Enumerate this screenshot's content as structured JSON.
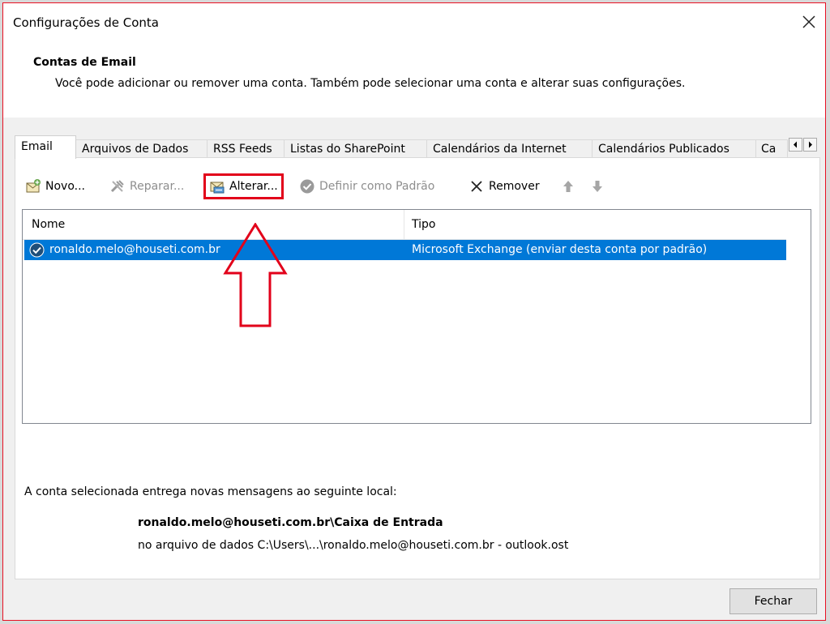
{
  "window": {
    "title": "Configurações de Conta"
  },
  "header": {
    "section_title": "Contas de Email",
    "description": "Você pode adicionar ou remover uma conta. Também pode selecionar uma conta e alterar suas configurações."
  },
  "tabs": [
    {
      "label": "Email",
      "active": true
    },
    {
      "label": "Arquivos de Dados"
    },
    {
      "label": "RSS Feeds"
    },
    {
      "label": "Listas do SharePoint"
    },
    {
      "label": "Calendários da Internet"
    },
    {
      "label": "Calendários Publicados"
    },
    {
      "label": "Ca"
    }
  ],
  "toolbar": {
    "new_label": "Novo...",
    "repair_label": "Reparar...",
    "change_label": "Alterar...",
    "set_default_label": "Definir como Padrão",
    "remove_label": "Remover"
  },
  "accounts_table": {
    "columns": [
      "Nome",
      "Tipo"
    ],
    "rows": [
      {
        "name": "ronaldo.melo@houseti.com.br",
        "type": "Microsoft Exchange (enviar desta conta por padrão)",
        "selected": true
      }
    ]
  },
  "delivery": {
    "info": "A conta selecionada entrega novas mensagens ao seguinte local:",
    "folder_path": "ronaldo.melo@houseti.com.br\\Caixa de Entrada",
    "data_file": "no arquivo de dados C:\\Users\\...\\ronaldo.melo@houseti.com.br - outlook.ost"
  },
  "footer": {
    "close_label": "Fechar"
  },
  "colors": {
    "selection": "#0078d7",
    "annotation": "#e2001a"
  }
}
